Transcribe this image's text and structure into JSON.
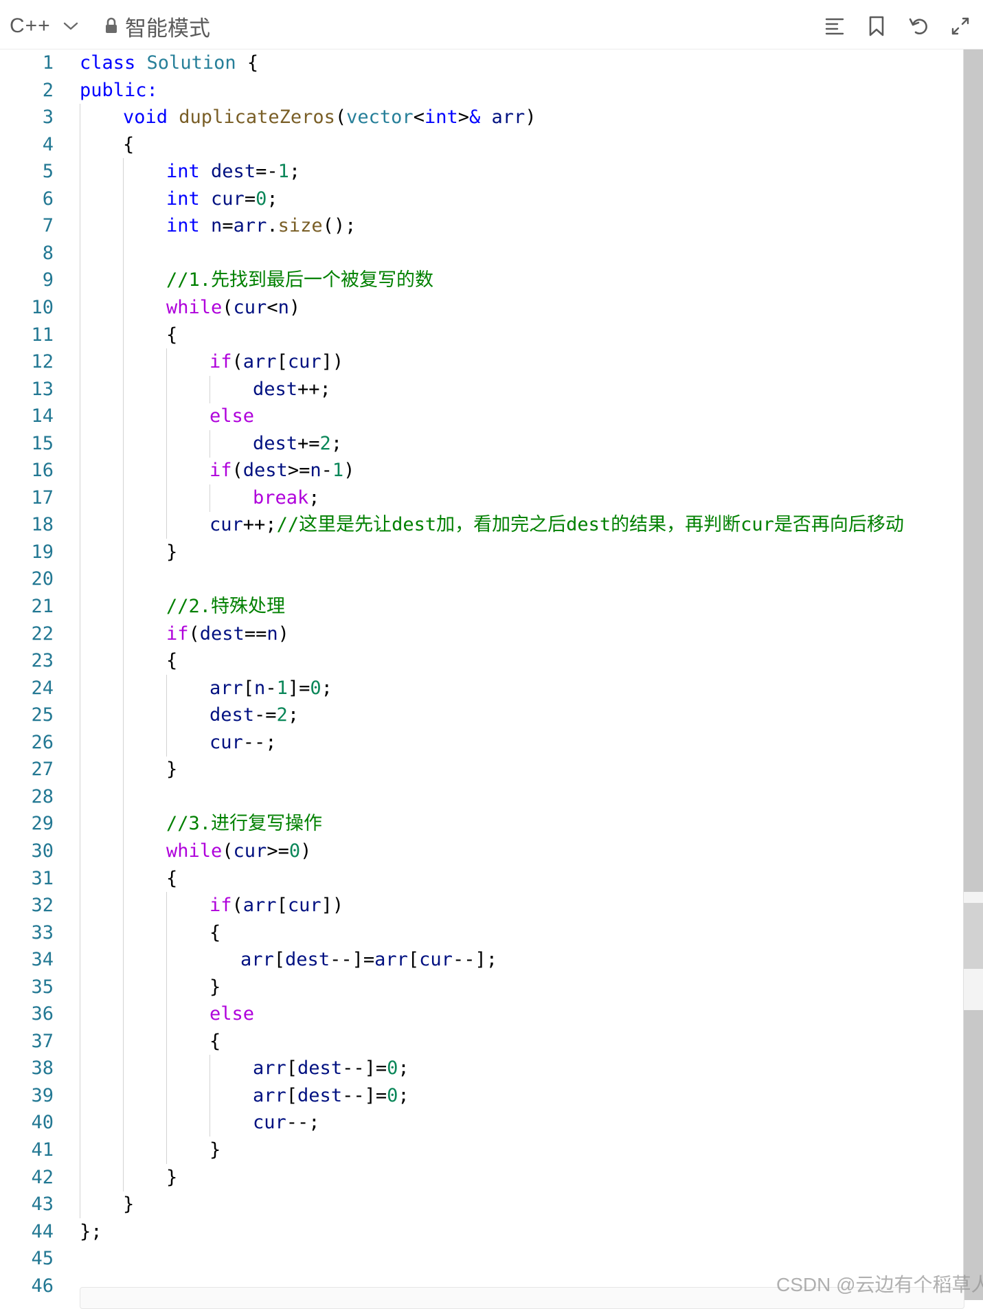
{
  "toolbar": {
    "language": "C++",
    "mode_label": "智能模式",
    "icons": [
      "lock-icon",
      "chevron-down-icon",
      "format-align-icon",
      "bookmark-icon",
      "undo-icon",
      "expand-icon"
    ]
  },
  "editor": {
    "line_number_color": "#237893",
    "token_colors": {
      "keyword": "#0000ff",
      "type": "#267f99",
      "control": "#af00db",
      "function": "#795e26",
      "variable": "#001080",
      "number": "#098658",
      "comment": "#008000"
    },
    "lines": [
      {
        "n": "1",
        "indent": 0,
        "tokens": [
          [
            "kw",
            "class"
          ],
          [
            "plain",
            " "
          ],
          [
            "type",
            "Solution"
          ],
          [
            "plain",
            " {"
          ]
        ]
      },
      {
        "n": "2",
        "indent": 0,
        "tokens": [
          [
            "kw",
            "public:"
          ]
        ]
      },
      {
        "n": "3",
        "indent": 1,
        "tokens": [
          [
            "kw",
            "void"
          ],
          [
            "plain",
            " "
          ],
          [
            "fn",
            "duplicateZeros"
          ],
          [
            "plain",
            "("
          ],
          [
            "type",
            "vector"
          ],
          [
            "plain",
            "<"
          ],
          [
            "kw",
            "int"
          ],
          [
            "plain",
            ">"
          ],
          [
            "kw",
            "&"
          ],
          [
            "plain",
            " "
          ],
          [
            "var",
            "arr"
          ],
          [
            "plain",
            ")"
          ]
        ]
      },
      {
        "n": "4",
        "indent": 1,
        "tokens": [
          [
            "plain",
            "{"
          ]
        ]
      },
      {
        "n": "5",
        "indent": 2,
        "tokens": [
          [
            "kw",
            "int"
          ],
          [
            "plain",
            " "
          ],
          [
            "var",
            "dest"
          ],
          [
            "plain",
            "=-"
          ],
          [
            "num",
            "1"
          ],
          [
            "plain",
            ";"
          ]
        ]
      },
      {
        "n": "6",
        "indent": 2,
        "tokens": [
          [
            "kw",
            "int"
          ],
          [
            "plain",
            " "
          ],
          [
            "var",
            "cur"
          ],
          [
            "plain",
            "="
          ],
          [
            "num",
            "0"
          ],
          [
            "plain",
            ";"
          ]
        ]
      },
      {
        "n": "7",
        "indent": 2,
        "tokens": [
          [
            "kw",
            "int"
          ],
          [
            "plain",
            " "
          ],
          [
            "var",
            "n"
          ],
          [
            "plain",
            "="
          ],
          [
            "var",
            "arr"
          ],
          [
            "plain",
            "."
          ],
          [
            "fn",
            "size"
          ],
          [
            "plain",
            "();"
          ]
        ]
      },
      {
        "n": "8",
        "indent": 2,
        "tokens": []
      },
      {
        "n": "9",
        "indent": 2,
        "tokens": [
          [
            "cmt",
            "//1.先找到最后一个被复写的数"
          ]
        ]
      },
      {
        "n": "10",
        "indent": 2,
        "tokens": [
          [
            "ctl",
            "while"
          ],
          [
            "plain",
            "("
          ],
          [
            "var",
            "cur"
          ],
          [
            "plain",
            "<"
          ],
          [
            "var",
            "n"
          ],
          [
            "plain",
            ")"
          ]
        ]
      },
      {
        "n": "11",
        "indent": 2,
        "tokens": [
          [
            "plain",
            "{"
          ]
        ]
      },
      {
        "n": "12",
        "indent": 3,
        "tokens": [
          [
            "ctl",
            "if"
          ],
          [
            "plain",
            "("
          ],
          [
            "var",
            "arr"
          ],
          [
            "plain",
            "["
          ],
          [
            "var",
            "cur"
          ],
          [
            "plain",
            "])"
          ]
        ]
      },
      {
        "n": "13",
        "indent": 4,
        "tokens": [
          [
            "var",
            "dest"
          ],
          [
            "plain",
            "++;"
          ]
        ]
      },
      {
        "n": "14",
        "indent": 3,
        "tokens": [
          [
            "ctl",
            "else"
          ]
        ]
      },
      {
        "n": "15",
        "indent": 4,
        "tokens": [
          [
            "var",
            "dest"
          ],
          [
            "plain",
            "+="
          ],
          [
            "num",
            "2"
          ],
          [
            "plain",
            ";"
          ]
        ]
      },
      {
        "n": "16",
        "indent": 3,
        "tokens": [
          [
            "ctl",
            "if"
          ],
          [
            "plain",
            "("
          ],
          [
            "var",
            "dest"
          ],
          [
            "plain",
            ">="
          ],
          [
            "var",
            "n"
          ],
          [
            "plain",
            "-"
          ],
          [
            "num",
            "1"
          ],
          [
            "plain",
            ")"
          ]
        ]
      },
      {
        "n": "17",
        "indent": 4,
        "tokens": [
          [
            "ctl",
            "break"
          ],
          [
            "plain",
            ";"
          ]
        ]
      },
      {
        "n": "18",
        "indent": 3,
        "tokens": [
          [
            "var",
            "cur"
          ],
          [
            "plain",
            "++;"
          ],
          [
            "cmt",
            "//这里是先让dest加，看加完之后dest的结果，再判断cur是否再向后移动"
          ]
        ]
      },
      {
        "n": "19",
        "indent": 2,
        "tokens": [
          [
            "plain",
            "}"
          ]
        ]
      },
      {
        "n": "20",
        "indent": 2,
        "tokens": []
      },
      {
        "n": "21",
        "indent": 2,
        "tokens": [
          [
            "cmt",
            "//2.特殊处理"
          ]
        ]
      },
      {
        "n": "22",
        "indent": 2,
        "tokens": [
          [
            "ctl",
            "if"
          ],
          [
            "plain",
            "("
          ],
          [
            "var",
            "dest"
          ],
          [
            "plain",
            "=="
          ],
          [
            "var",
            "n"
          ],
          [
            "plain",
            ")"
          ]
        ]
      },
      {
        "n": "23",
        "indent": 2,
        "tokens": [
          [
            "plain",
            "{"
          ]
        ]
      },
      {
        "n": "24",
        "indent": 3,
        "tokens": [
          [
            "var",
            "arr"
          ],
          [
            "plain",
            "["
          ],
          [
            "var",
            "n"
          ],
          [
            "plain",
            "-"
          ],
          [
            "num",
            "1"
          ],
          [
            "plain",
            "]="
          ],
          [
            "num",
            "0"
          ],
          [
            "plain",
            ";"
          ]
        ]
      },
      {
        "n": "25",
        "indent": 3,
        "tokens": [
          [
            "var",
            "dest"
          ],
          [
            "plain",
            "-="
          ],
          [
            "num",
            "2"
          ],
          [
            "plain",
            ";"
          ]
        ]
      },
      {
        "n": "26",
        "indent": 3,
        "tokens": [
          [
            "var",
            "cur"
          ],
          [
            "plain",
            "--;"
          ]
        ]
      },
      {
        "n": "27",
        "indent": 2,
        "tokens": [
          [
            "plain",
            "}"
          ]
        ]
      },
      {
        "n": "28",
        "indent": 2,
        "tokens": []
      },
      {
        "n": "29",
        "indent": 2,
        "tokens": [
          [
            "cmt",
            "//3.进行复写操作"
          ]
        ]
      },
      {
        "n": "30",
        "indent": 2,
        "tokens": [
          [
            "ctl",
            "while"
          ],
          [
            "plain",
            "("
          ],
          [
            "var",
            "cur"
          ],
          [
            "plain",
            ">="
          ],
          [
            "num",
            "0"
          ],
          [
            "plain",
            ")"
          ]
        ]
      },
      {
        "n": "31",
        "indent": 2,
        "tokens": [
          [
            "plain",
            "{"
          ]
        ]
      },
      {
        "n": "32",
        "indent": 3,
        "tokens": [
          [
            "ctl",
            "if"
          ],
          [
            "plain",
            "("
          ],
          [
            "var",
            "arr"
          ],
          [
            "plain",
            "["
          ],
          [
            "var",
            "cur"
          ],
          [
            "plain",
            "])"
          ]
        ]
      },
      {
        "n": "33",
        "indent": 3,
        "tokens": [
          [
            "plain",
            "{"
          ]
        ]
      },
      {
        "n": "34",
        "indent": 3,
        "pad": "   ",
        "tokens": [
          [
            "var",
            "arr"
          ],
          [
            "plain",
            "["
          ],
          [
            "var",
            "dest"
          ],
          [
            "plain",
            "--]="
          ],
          [
            "var",
            "arr"
          ],
          [
            "plain",
            "["
          ],
          [
            "var",
            "cur"
          ],
          [
            "plain",
            "--];"
          ]
        ]
      },
      {
        "n": "35",
        "indent": 3,
        "tokens": [
          [
            "plain",
            "}"
          ]
        ]
      },
      {
        "n": "36",
        "indent": 3,
        "tokens": [
          [
            "ctl",
            "else"
          ]
        ]
      },
      {
        "n": "37",
        "indent": 3,
        "tokens": [
          [
            "plain",
            "{"
          ]
        ]
      },
      {
        "n": "38",
        "indent": 4,
        "tokens": [
          [
            "var",
            "arr"
          ],
          [
            "plain",
            "["
          ],
          [
            "var",
            "dest"
          ],
          [
            "plain",
            "--]="
          ],
          [
            "num",
            "0"
          ],
          [
            "plain",
            ";"
          ]
        ]
      },
      {
        "n": "39",
        "indent": 4,
        "tokens": [
          [
            "var",
            "arr"
          ],
          [
            "plain",
            "["
          ],
          [
            "var",
            "dest"
          ],
          [
            "plain",
            "--]="
          ],
          [
            "num",
            "0"
          ],
          [
            "plain",
            ";"
          ]
        ]
      },
      {
        "n": "40",
        "indent": 4,
        "tokens": [
          [
            "var",
            "cur"
          ],
          [
            "plain",
            "--;"
          ]
        ]
      },
      {
        "n": "41",
        "indent": 3,
        "tokens": [
          [
            "plain",
            "}"
          ]
        ]
      },
      {
        "n": "42",
        "indent": 2,
        "tokens": [
          [
            "plain",
            "}"
          ]
        ]
      },
      {
        "n": "43",
        "indent": 1,
        "tokens": [
          [
            "plain",
            "}"
          ]
        ]
      },
      {
        "n": "44",
        "indent": 0,
        "tokens": [
          [
            "plain",
            "};"
          ]
        ]
      },
      {
        "n": "45",
        "indent": 0,
        "tokens": []
      },
      {
        "n": "46",
        "indent": 0,
        "tokens": []
      }
    ]
  },
  "watermark": "CSDN @云边有个稻草人"
}
